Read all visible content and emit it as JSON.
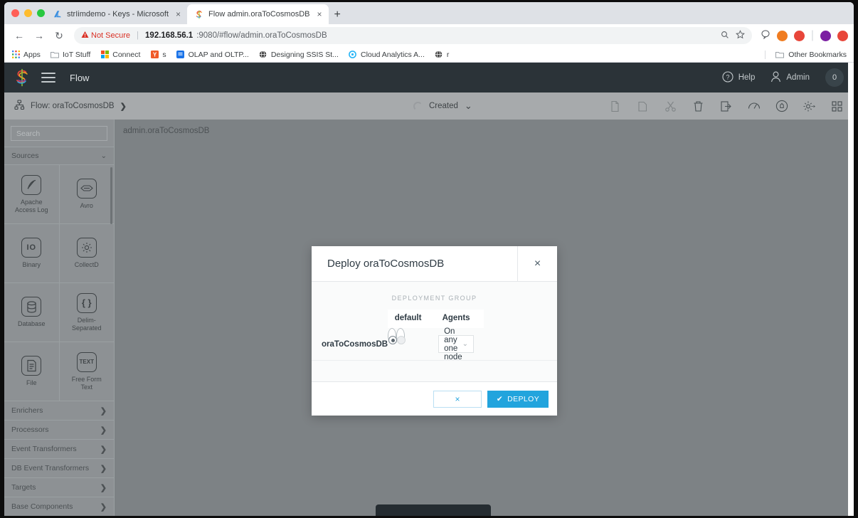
{
  "browser": {
    "tabs": [
      {
        "title": "strIimdemo - Keys - Microsoft",
        "favicon": "azure-icon",
        "active": false,
        "close_label": "×"
      },
      {
        "title": "Flow admin.oraToCosmosDB",
        "favicon": "striim-icon",
        "active": true,
        "close_label": "×"
      }
    ],
    "new_tab_label": "+",
    "nav": {
      "back": "←",
      "forward": "→",
      "reload": "↻"
    },
    "omnibox": {
      "security_label": "Not Secure",
      "security_icon": "warning-triangle-icon",
      "url_host": "192.168.56.1",
      "url_rest": ":9080/#flow/admin.oraToCosmosDB",
      "zoom_icon": "zoom-icon",
      "bookmark_icon": "star-icon"
    },
    "bookmarks": [
      {
        "label": "Apps",
        "icon": "apps-grid-icon"
      },
      {
        "label": "IoT Stuff",
        "icon": "folder-icon"
      },
      {
        "label": "Connect",
        "icon": "microsoft-icon"
      },
      {
        "label": "s",
        "icon": "yahoo-icon"
      },
      {
        "label": "OLAP and OLTP...",
        "icon": "blue-page-icon"
      },
      {
        "label": "Designing SSIS St...",
        "icon": "globe-icon"
      },
      {
        "label": "Cloud Analytics A...",
        "icon": "cyan-circle-icon"
      },
      {
        "label": "r",
        "icon": "globe-icon"
      }
    ],
    "other_bookmarks": {
      "label": "Other Bookmarks",
      "icon": "folder-icon"
    }
  },
  "app": {
    "logo_name": "striim-logo",
    "menu_icon": "hamburger-icon",
    "title": "Flow",
    "help": {
      "label": "Help",
      "icon": "question-circle-icon"
    },
    "user": {
      "label": "Admin",
      "icon": "user-icon"
    },
    "notification_count": "0"
  },
  "subheader": {
    "breadcrumb_icon": "flow-nodes-icon",
    "breadcrumb": "Flow: oraToCosmosDB",
    "breadcrumb_arrow": "❯",
    "status_label": "Created",
    "status_caret": "⌄",
    "spinner": "loading-spinner",
    "tools": [
      {
        "name": "copy-page-icon",
        "dim": true
      },
      {
        "name": "duplicate-icon",
        "dim": true
      },
      {
        "name": "scissors-icon",
        "dim": true
      },
      {
        "name": "trash-icon",
        "dim": false
      },
      {
        "name": "export-icon",
        "dim": false
      },
      {
        "name": "gauge-icon",
        "dim": false
      },
      {
        "name": "alert-bell-icon",
        "dim": false
      },
      {
        "name": "settings-gear-icon",
        "dim": false
      },
      {
        "name": "grid-apps-icon",
        "dim": false
      }
    ]
  },
  "sidebar": {
    "search_placeholder": "Search",
    "sources_group": {
      "label": "Sources",
      "chevron": "⌄"
    },
    "components": [
      {
        "label": "Apache\nAccess Log",
        "icon": "feather-pen-icon",
        "glyph": "✐"
      },
      {
        "label": "Avro",
        "icon": "avro-icon",
        "glyph": "⬟"
      },
      {
        "label": "Binary",
        "icon": "binary-io-icon",
        "glyph": "IO"
      },
      {
        "label": "CollectD",
        "icon": "collectd-sun-icon",
        "glyph": "☀"
      },
      {
        "label": "Database",
        "icon": "database-icon",
        "glyph": "⛁"
      },
      {
        "label": "Delim-\nSeparated",
        "icon": "braces-icon",
        "glyph": "{ }"
      },
      {
        "label": "File",
        "icon": "file-lines-icon",
        "glyph": "☰"
      },
      {
        "label": "Free Form\nText",
        "icon": "text-icon",
        "glyph": "TEXT"
      }
    ],
    "categories": [
      {
        "label": "Enrichers",
        "chevron": "❯"
      },
      {
        "label": "Processors",
        "chevron": "❯"
      },
      {
        "label": "Event Transformers",
        "chevron": "❯"
      },
      {
        "label": "DB Event Transformers",
        "chevron": "❯"
      },
      {
        "label": "Targets",
        "chevron": "❯"
      },
      {
        "label": "Base Components",
        "chevron": "❯"
      }
    ]
  },
  "canvas": {
    "flow_label": "admin.oraToCosmosDB"
  },
  "modal": {
    "title": "Deploy oraToCosmosDB",
    "close_label": "×",
    "section_label": "DEPLOYMENT GROUP",
    "columns": [
      "default",
      "Agents"
    ],
    "rows": [
      {
        "name": "oraToCosmosDB",
        "default_selected": true,
        "agents_selected": false,
        "node_option": "On any one node",
        "node_caret": "⌄"
      }
    ],
    "cancel_label": "×",
    "deploy_label": "DEPLOY",
    "deploy_check": "✔"
  },
  "colors": {
    "accent_blue": "#22a4dd",
    "header_dark": "#2b3338",
    "subheader_gray": "#a7aaac",
    "overlay_gray": "#7d8285",
    "not_secure_red": "#d93025"
  }
}
